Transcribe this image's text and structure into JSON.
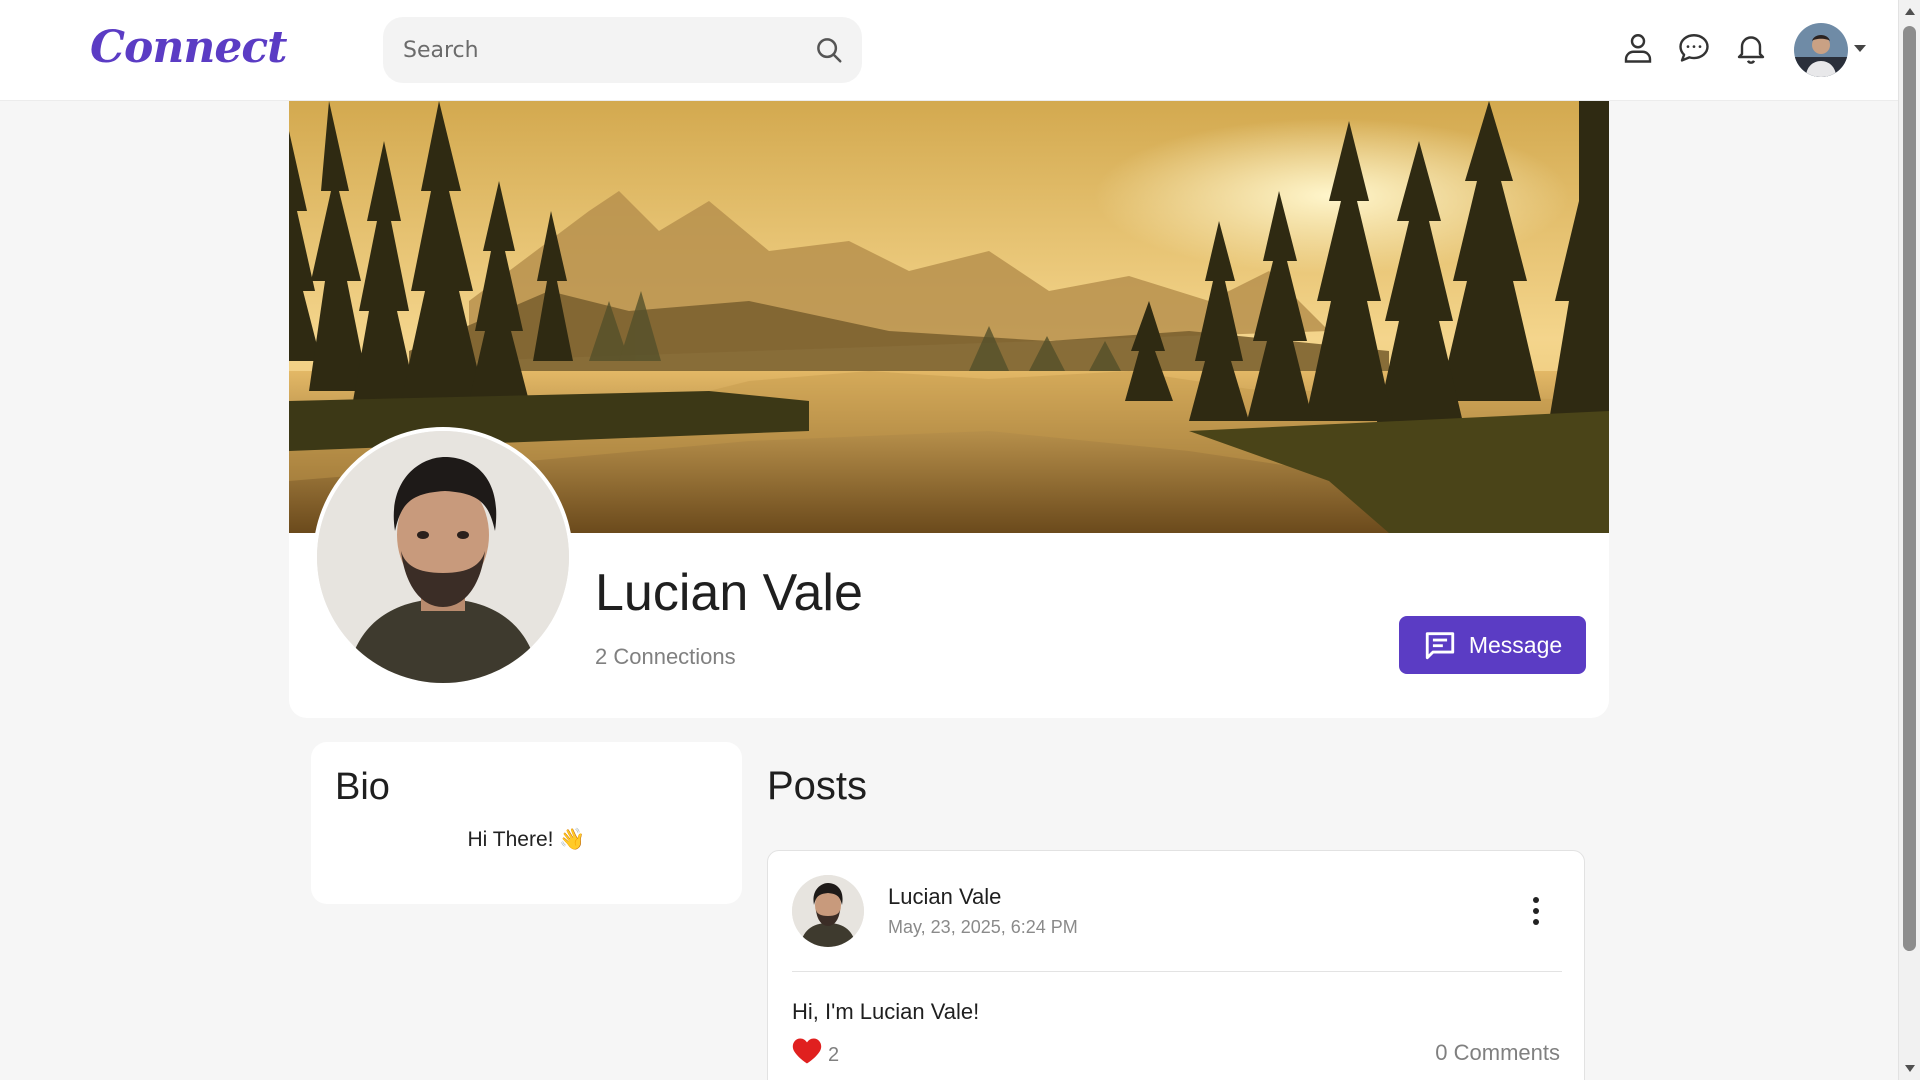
{
  "app": {
    "logo_text": "Connect",
    "brand_color": "#5b3cc4"
  },
  "search": {
    "placeholder": "Search",
    "value": "",
    "icon": "search-icon"
  },
  "nav": {
    "icons": [
      "user-icon",
      "chat-icon",
      "bell-icon"
    ],
    "avatar": "user-avatar",
    "caret": "caret-down-icon"
  },
  "profile": {
    "name": "Lucian Vale",
    "connections": "2 Connections",
    "message_label": "Message"
  },
  "bio": {
    "title": "Bio",
    "text": "Hi There! 👋"
  },
  "posts": {
    "title": "Posts",
    "items": [
      {
        "author": "Lucian Vale",
        "date": "May, 23, 2025, 6:24 PM",
        "text": "Hi, I'm Lucian Vale!",
        "likes": "2",
        "comments": "0 Comments",
        "like_color": "#e0201f"
      }
    ]
  }
}
